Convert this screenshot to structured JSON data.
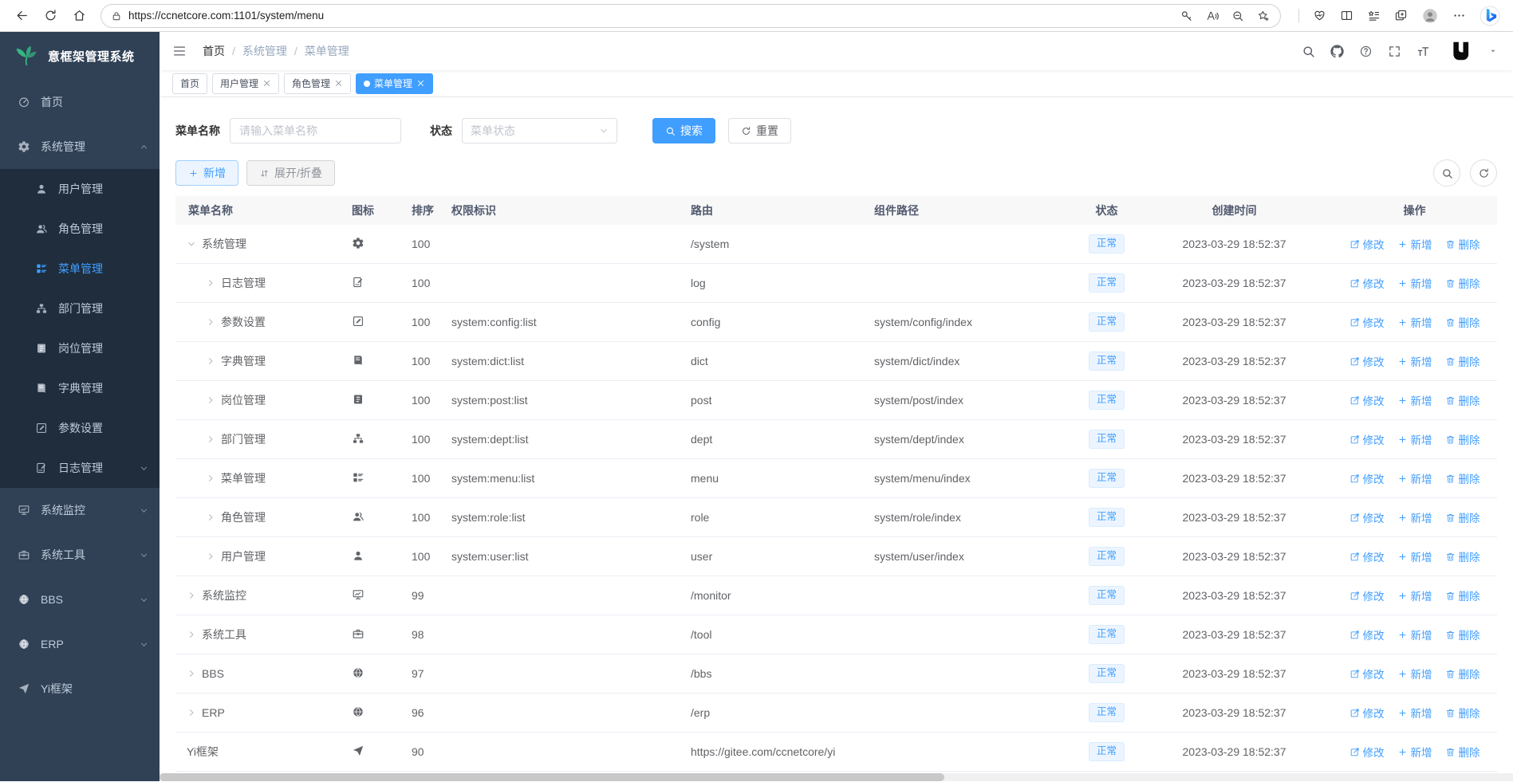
{
  "browser": {
    "url": "https://ccnetcore.com:1101/system/menu",
    "nav_icons": [
      "arrow-left",
      "reload",
      "home"
    ],
    "pill_icons": [
      "key",
      "read-aloud",
      "zoom-out",
      "favorites-add"
    ],
    "action_icons": [
      "browser-essentials",
      "split-screen",
      "collections",
      "tabs",
      "profile",
      "more",
      "bing"
    ]
  },
  "sidebar": {
    "title": "意框架管理系统",
    "items": [
      {
        "key": "home",
        "label": "首页",
        "icon": "dashboard"
      },
      {
        "key": "system",
        "label": "系统管理",
        "icon": "gear",
        "arrow": "up",
        "children": [
          {
            "key": "user",
            "label": "用户管理",
            "icon": "user"
          },
          {
            "key": "role",
            "label": "角色管理",
            "icon": "users"
          },
          {
            "key": "menu",
            "label": "菜单管理",
            "icon": "menu-tree",
            "active": true
          },
          {
            "key": "dept",
            "label": "部门管理",
            "icon": "org"
          },
          {
            "key": "post",
            "label": "岗位管理",
            "icon": "id-badge"
          },
          {
            "key": "dict",
            "label": "字典管理",
            "icon": "book"
          },
          {
            "key": "config",
            "label": "参数设置",
            "icon": "edit-square"
          },
          {
            "key": "log",
            "label": "日志管理",
            "icon": "log",
            "arrow": "down"
          }
        ]
      },
      {
        "key": "monitor",
        "label": "系统监控",
        "icon": "monitor",
        "arrow": "down"
      },
      {
        "key": "tool",
        "label": "系统工具",
        "icon": "toolbox",
        "arrow": "down"
      },
      {
        "key": "bbs",
        "label": "BBS",
        "icon": "globe",
        "arrow": "down"
      },
      {
        "key": "erp",
        "label": "ERP",
        "icon": "globe",
        "arrow": "down"
      },
      {
        "key": "yi",
        "label": "Yi框架",
        "icon": "send"
      }
    ]
  },
  "navbar": {
    "breadcrumb": [
      "首页",
      "系统管理",
      "菜单管理"
    ],
    "icons": [
      "search",
      "github",
      "question",
      "fullscreen",
      "font-size"
    ]
  },
  "tabs": [
    {
      "key": "home",
      "label": "首页",
      "closable": false,
      "active": false
    },
    {
      "key": "user",
      "label": "用户管理",
      "closable": true,
      "active": false
    },
    {
      "key": "role",
      "label": "角色管理",
      "closable": true,
      "active": false
    },
    {
      "key": "menu",
      "label": "菜单管理",
      "closable": true,
      "active": true
    }
  ],
  "filters": {
    "name_label": "菜单名称",
    "name_placeholder": "请输入菜单名称",
    "status_label": "状态",
    "status_placeholder": "菜单状态",
    "search_label": "搜索",
    "reset_label": "重置"
  },
  "toolbar": {
    "add_label": "新增",
    "expand_label": "展开/折叠"
  },
  "table": {
    "columns": [
      "菜单名称",
      "图标",
      "排序",
      "权限标识",
      "路由",
      "组件路径",
      "状态",
      "创建时间",
      "操作"
    ],
    "actions": {
      "edit": "修改",
      "add": "新增",
      "delete": "删除"
    },
    "rows": [
      {
        "name": "系统管理",
        "icon": "gear",
        "level": 0,
        "chevron": "down",
        "sort": "100",
        "perms": "",
        "route": "/system",
        "component": "",
        "status": "正常",
        "created": "2023-03-29 18:52:37"
      },
      {
        "name": "日志管理",
        "icon": "log",
        "level": 1,
        "chevron": "right",
        "sort": "100",
        "perms": "",
        "route": "log",
        "component": "",
        "status": "正常",
        "created": "2023-03-29 18:52:37"
      },
      {
        "name": "参数设置",
        "icon": "edit-square",
        "level": 1,
        "chevron": "right",
        "sort": "100",
        "perms": "system:config:list",
        "route": "config",
        "component": "system/config/index",
        "status": "正常",
        "created": "2023-03-29 18:52:37"
      },
      {
        "name": "字典管理",
        "icon": "book",
        "level": 1,
        "chevron": "right",
        "sort": "100",
        "perms": "system:dict:list",
        "route": "dict",
        "component": "system/dict/index",
        "status": "正常",
        "created": "2023-03-29 18:52:37"
      },
      {
        "name": "岗位管理",
        "icon": "id-badge",
        "level": 1,
        "chevron": "right",
        "sort": "100",
        "perms": "system:post:list",
        "route": "post",
        "component": "system/post/index",
        "status": "正常",
        "created": "2023-03-29 18:52:37"
      },
      {
        "name": "部门管理",
        "icon": "org",
        "level": 1,
        "chevron": "right",
        "sort": "100",
        "perms": "system:dept:list",
        "route": "dept",
        "component": "system/dept/index",
        "status": "正常",
        "created": "2023-03-29 18:52:37"
      },
      {
        "name": "菜单管理",
        "icon": "menu-tree",
        "level": 1,
        "chevron": "right",
        "sort": "100",
        "perms": "system:menu:list",
        "route": "menu",
        "component": "system/menu/index",
        "status": "正常",
        "created": "2023-03-29 18:52:37"
      },
      {
        "name": "角色管理",
        "icon": "users",
        "level": 1,
        "chevron": "right",
        "sort": "100",
        "perms": "system:role:list",
        "route": "role",
        "component": "system/role/index",
        "status": "正常",
        "created": "2023-03-29 18:52:37"
      },
      {
        "name": "用户管理",
        "icon": "user",
        "level": 1,
        "chevron": "right",
        "sort": "100",
        "perms": "system:user:list",
        "route": "user",
        "component": "system/user/index",
        "status": "正常",
        "created": "2023-03-29 18:52:37"
      },
      {
        "name": "系统监控",
        "icon": "monitor",
        "level": 0,
        "chevron": "right",
        "sort": "99",
        "perms": "",
        "route": "/monitor",
        "component": "",
        "status": "正常",
        "created": "2023-03-29 18:52:37"
      },
      {
        "name": "系统工具",
        "icon": "toolbox",
        "level": 0,
        "chevron": "right",
        "sort": "98",
        "perms": "",
        "route": "/tool",
        "component": "",
        "status": "正常",
        "created": "2023-03-29 18:52:37"
      },
      {
        "name": "BBS",
        "icon": "globe",
        "level": 0,
        "chevron": "right",
        "sort": "97",
        "perms": "",
        "route": "/bbs",
        "component": "",
        "status": "正常",
        "created": "2023-03-29 18:52:37"
      },
      {
        "name": "ERP",
        "icon": "globe",
        "level": 0,
        "chevron": "right",
        "sort": "96",
        "perms": "",
        "route": "/erp",
        "component": "",
        "status": "正常",
        "created": "2023-03-29 18:52:37"
      },
      {
        "name": "Yi框架",
        "icon": "send",
        "level": 0,
        "chevron": "none",
        "sort": "90",
        "perms": "",
        "route": "https://gitee.com/ccnetcore/yi",
        "component": "",
        "status": "正常",
        "created": "2023-03-29 18:52:37"
      }
    ]
  },
  "colors": {
    "accent": "#409eff",
    "sidebar_bg": "#304156",
    "sidebar_sub_bg": "#1f2d3d",
    "status_tag_bg": "#ecf5ff",
    "table_header_bg": "#f8f8f9"
  }
}
